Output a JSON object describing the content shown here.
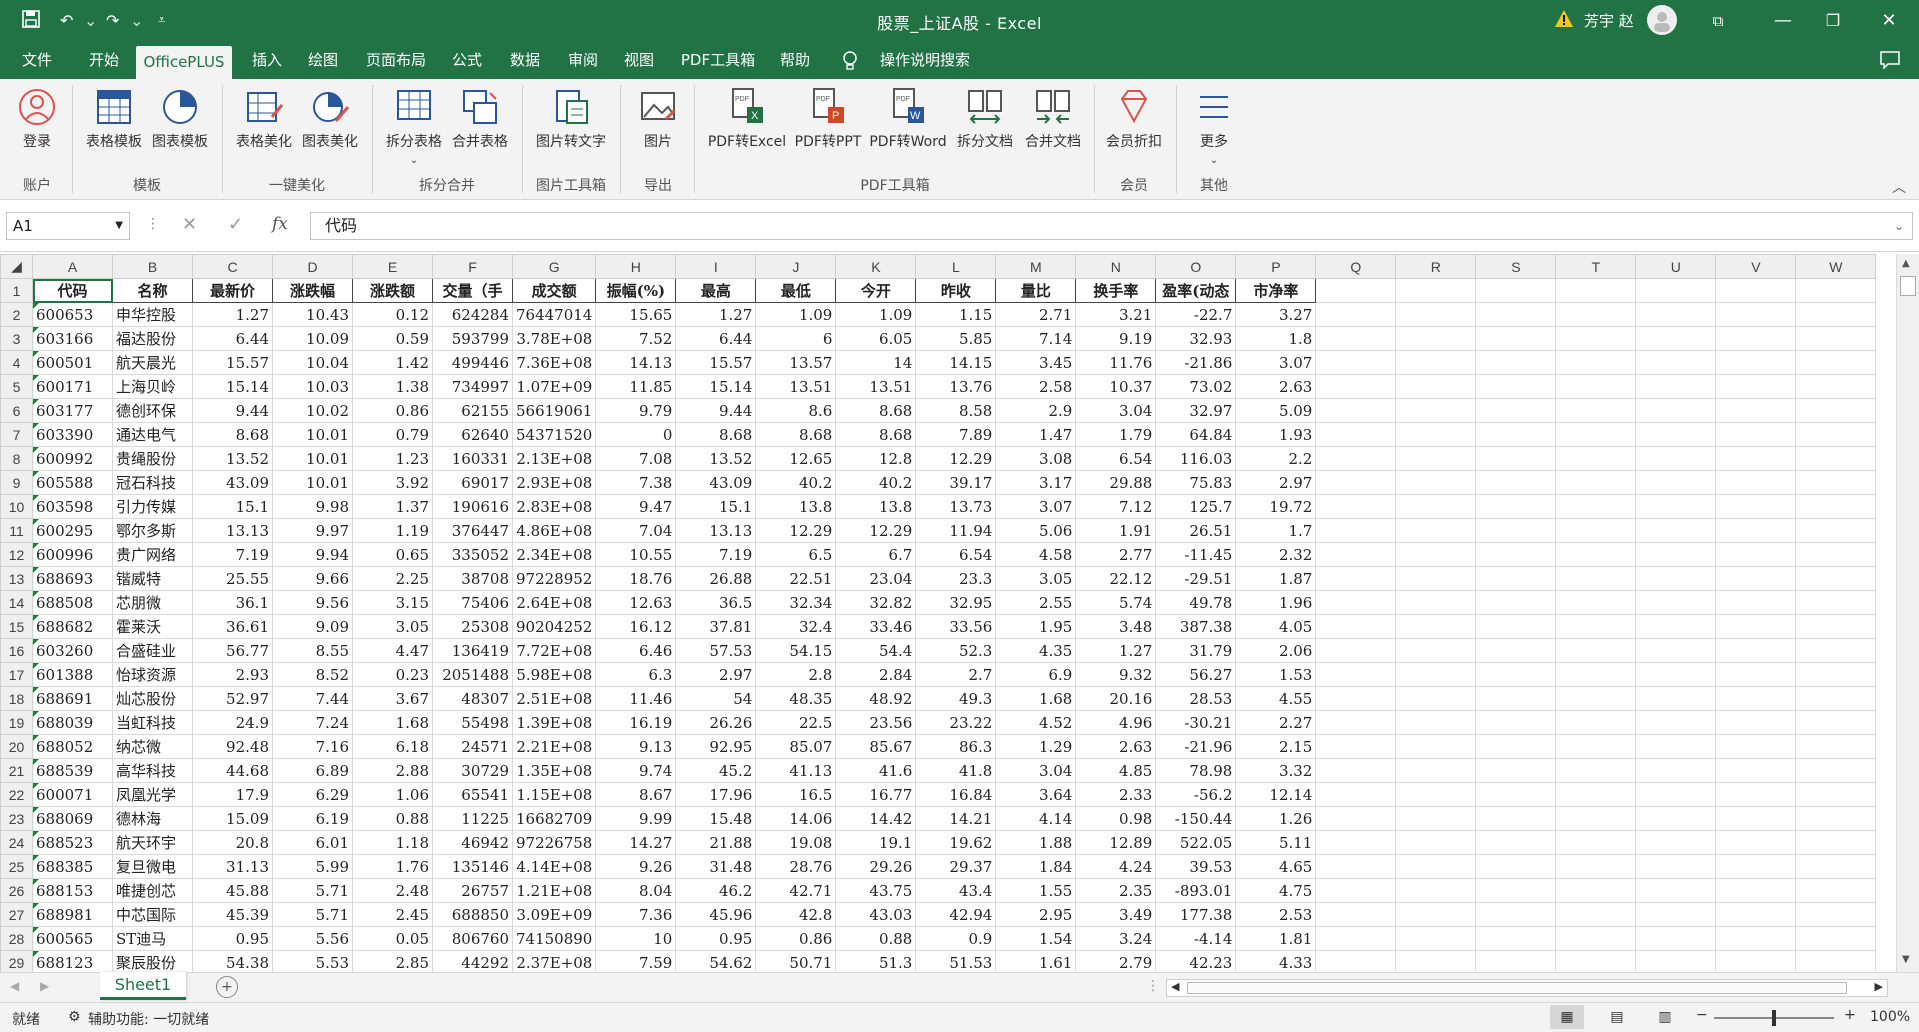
{
  "window": {
    "title": "股票_上证A股 - Excel",
    "user": "芳宇 赵"
  },
  "quick_access": {
    "save": "💾",
    "undo": "↶",
    "redo": "↷"
  },
  "menu": [
    "文件",
    "开始",
    "OfficePLUS",
    "插入",
    "绘图",
    "页面布局",
    "公式",
    "数据",
    "审阅",
    "视图",
    "PDF工具箱",
    "帮助",
    "操作说明搜索"
  ],
  "ribbon": {
    "buttons": [
      "登录",
      "表格模板",
      "图表模板",
      "表格美化",
      "图表美化",
      "拆分表格",
      "合并表格",
      "图片转文字",
      "图片",
      "PDF转Excel",
      "PDF转PPT",
      "PDF转Word",
      "拆分文档",
      "合并文档",
      "会员折扣",
      "更多"
    ],
    "groups": [
      "账户",
      "模板",
      "一键美化",
      "拆分合并",
      "图片工具箱",
      "导出",
      "PDF工具箱",
      "会员",
      "其他"
    ]
  },
  "formula_bar": {
    "name_box": "A1",
    "fx": "fx",
    "value": "代码"
  },
  "columns": [
    "A",
    "B",
    "C",
    "D",
    "E",
    "F",
    "G",
    "H",
    "I",
    "J",
    "K",
    "L",
    "M",
    "N",
    "O",
    "P",
    "Q",
    "R",
    "S",
    "T",
    "U",
    "V",
    "W"
  ],
  "header_row": [
    "代码",
    "名称",
    "最新价",
    "涨跌幅",
    "涨跌额",
    "交量（手",
    "成交额",
    "振幅(%)",
    "最高",
    "最低",
    "今开",
    "昨收",
    "量比",
    "换手率",
    "盈率(动态",
    "市净率"
  ],
  "rows": [
    [
      "600653",
      "申华控股",
      "1.27",
      "10.43",
      "0.12",
      "624284",
      "76447014",
      "15.65",
      "1.27",
      "1.09",
      "1.09",
      "1.15",
      "2.71",
      "3.21",
      "-22.7",
      "3.27"
    ],
    [
      "603166",
      "福达股份",
      "6.44",
      "10.09",
      "0.59",
      "593799",
      "3.78E+08",
      "7.52",
      "6.44",
      "6",
      "6.05",
      "5.85",
      "7.14",
      "9.19",
      "32.93",
      "1.8"
    ],
    [
      "600501",
      "航天晨光",
      "15.57",
      "10.04",
      "1.42",
      "499446",
      "7.36E+08",
      "14.13",
      "15.57",
      "13.57",
      "14",
      "14.15",
      "3.45",
      "11.76",
      "-21.86",
      "3.07"
    ],
    [
      "600171",
      "上海贝岭",
      "15.14",
      "10.03",
      "1.38",
      "734997",
      "1.07E+09",
      "11.85",
      "15.14",
      "13.51",
      "13.51",
      "13.76",
      "2.58",
      "10.37",
      "73.02",
      "2.63"
    ],
    [
      "603177",
      "德创环保",
      "9.44",
      "10.02",
      "0.86",
      "62155",
      "56619061",
      "9.79",
      "9.44",
      "8.6",
      "8.68",
      "8.58",
      "2.9",
      "3.04",
      "32.97",
      "5.09"
    ],
    [
      "603390",
      "通达电气",
      "8.68",
      "10.01",
      "0.79",
      "62640",
      "54371520",
      "0",
      "8.68",
      "8.68",
      "8.68",
      "7.89",
      "1.47",
      "1.79",
      "64.84",
      "1.93"
    ],
    [
      "600992",
      "贵绳股份",
      "13.52",
      "10.01",
      "1.23",
      "160331",
      "2.13E+08",
      "7.08",
      "13.52",
      "12.65",
      "12.8",
      "12.29",
      "3.08",
      "6.54",
      "116.03",
      "2.2"
    ],
    [
      "605588",
      "冠石科技",
      "43.09",
      "10.01",
      "3.92",
      "69017",
      "2.93E+08",
      "7.38",
      "43.09",
      "40.2",
      "40.2",
      "39.17",
      "3.17",
      "29.88",
      "75.83",
      "2.97"
    ],
    [
      "603598",
      "引力传媒",
      "15.1",
      "9.98",
      "1.37",
      "190616",
      "2.83E+08",
      "9.47",
      "15.1",
      "13.8",
      "13.8",
      "13.73",
      "3.07",
      "7.12",
      "125.7",
      "19.72"
    ],
    [
      "600295",
      "鄂尔多斯",
      "13.13",
      "9.97",
      "1.19",
      "376447",
      "4.86E+08",
      "7.04",
      "13.13",
      "12.29",
      "12.29",
      "11.94",
      "5.06",
      "1.91",
      "26.51",
      "1.7"
    ],
    [
      "600996",
      "贵广网络",
      "7.19",
      "9.94",
      "0.65",
      "335052",
      "2.34E+08",
      "10.55",
      "7.19",
      "6.5",
      "6.7",
      "6.54",
      "4.58",
      "2.77",
      "-11.45",
      "2.32"
    ],
    [
      "688693",
      "锴威特",
      "25.55",
      "9.66",
      "2.25",
      "38708",
      "97228952",
      "18.76",
      "26.88",
      "22.51",
      "23.04",
      "23.3",
      "3.05",
      "22.12",
      "-29.51",
      "1.87"
    ],
    [
      "688508",
      "芯朋微",
      "36.1",
      "9.56",
      "3.15",
      "75406",
      "2.64E+08",
      "12.63",
      "36.5",
      "32.34",
      "32.82",
      "32.95",
      "2.55",
      "5.74",
      "49.78",
      "1.96"
    ],
    [
      "688682",
      "霍莱沃",
      "36.61",
      "9.09",
      "3.05",
      "25308",
      "90204252",
      "16.12",
      "37.81",
      "32.4",
      "33.46",
      "33.56",
      "1.95",
      "3.48",
      "387.38",
      "4.05"
    ],
    [
      "603260",
      "合盛硅业",
      "56.77",
      "8.55",
      "4.47",
      "136419",
      "7.72E+08",
      "6.46",
      "57.53",
      "54.15",
      "54.4",
      "52.3",
      "4.35",
      "1.27",
      "31.79",
      "2.06"
    ],
    [
      "601388",
      "怡球资源",
      "2.93",
      "8.52",
      "0.23",
      "2051488",
      "5.98E+08",
      "6.3",
      "2.97",
      "2.8",
      "2.84",
      "2.7",
      "6.9",
      "9.32",
      "56.27",
      "1.53"
    ],
    [
      "688691",
      "灿芯股份",
      "52.97",
      "7.44",
      "3.67",
      "48307",
      "2.51E+08",
      "11.46",
      "54",
      "48.35",
      "48.92",
      "49.3",
      "1.68",
      "20.16",
      "28.53",
      "4.55"
    ],
    [
      "688039",
      "当虹科技",
      "24.9",
      "7.24",
      "1.68",
      "55498",
      "1.39E+08",
      "16.19",
      "26.26",
      "22.5",
      "23.56",
      "23.22",
      "4.52",
      "4.96",
      "-30.21",
      "2.27"
    ],
    [
      "688052",
      "纳芯微",
      "92.48",
      "7.16",
      "6.18",
      "24571",
      "2.21E+08",
      "9.13",
      "92.95",
      "85.07",
      "85.67",
      "86.3",
      "1.29",
      "2.63",
      "-21.96",
      "2.15"
    ],
    [
      "688539",
      "高华科技",
      "44.68",
      "6.89",
      "2.88",
      "30729",
      "1.35E+08",
      "9.74",
      "45.2",
      "41.13",
      "41.6",
      "41.8",
      "3.04",
      "4.85",
      "78.98",
      "3.32"
    ],
    [
      "600071",
      "凤凰光学",
      "17.9",
      "6.29",
      "1.06",
      "65541",
      "1.15E+08",
      "8.67",
      "17.96",
      "16.5",
      "16.77",
      "16.84",
      "3.64",
      "2.33",
      "-56.2",
      "12.14"
    ],
    [
      "688069",
      "德林海",
      "15.09",
      "6.19",
      "0.88",
      "11225",
      "16682709",
      "9.99",
      "15.48",
      "14.06",
      "14.42",
      "14.21",
      "4.14",
      "0.98",
      "-150.44",
      "1.26"
    ],
    [
      "688523",
      "航天环宇",
      "20.8",
      "6.01",
      "1.18",
      "46942",
      "97226758",
      "14.27",
      "21.88",
      "19.08",
      "19.1",
      "19.62",
      "1.88",
      "12.89",
      "522.05",
      "5.11"
    ],
    [
      "688385",
      "复旦微电",
      "31.13",
      "5.99",
      "1.76",
      "135146",
      "4.14E+08",
      "9.26",
      "31.48",
      "28.76",
      "29.26",
      "29.37",
      "1.84",
      "4.24",
      "39.53",
      "4.65"
    ],
    [
      "688153",
      "唯捷创芯",
      "45.88",
      "5.71",
      "2.48",
      "26757",
      "1.21E+08",
      "8.04",
      "46.2",
      "42.71",
      "43.75",
      "43.4",
      "1.55",
      "2.35",
      "-893.01",
      "4.75"
    ],
    [
      "688981",
      "中芯国际",
      "45.39",
      "5.71",
      "2.45",
      "688850",
      "3.09E+09",
      "7.36",
      "45.96",
      "42.8",
      "43.03",
      "42.94",
      "2.95",
      "3.49",
      "177.38",
      "2.53"
    ],
    [
      "600565",
      "ST迪马",
      "0.95",
      "5.56",
      "0.05",
      "806760",
      "74150890",
      "10",
      "0.95",
      "0.86",
      "0.88",
      "0.9",
      "1.54",
      "3.24",
      "-4.14",
      "1.81"
    ],
    [
      "688123",
      "聚辰股份",
      "54.38",
      "5.53",
      "2.85",
      "44292",
      "2.37E+08",
      "7.59",
      "54.62",
      "50.71",
      "51.3",
      "51.53",
      "1.61",
      "2.79",
      "42.23",
      "4.33"
    ]
  ],
  "sheet_tabs": [
    "Sheet1"
  ],
  "status": {
    "ready": "就绪",
    "accessibility": "辅助功能: 一切就绪",
    "zoom": "100%"
  }
}
